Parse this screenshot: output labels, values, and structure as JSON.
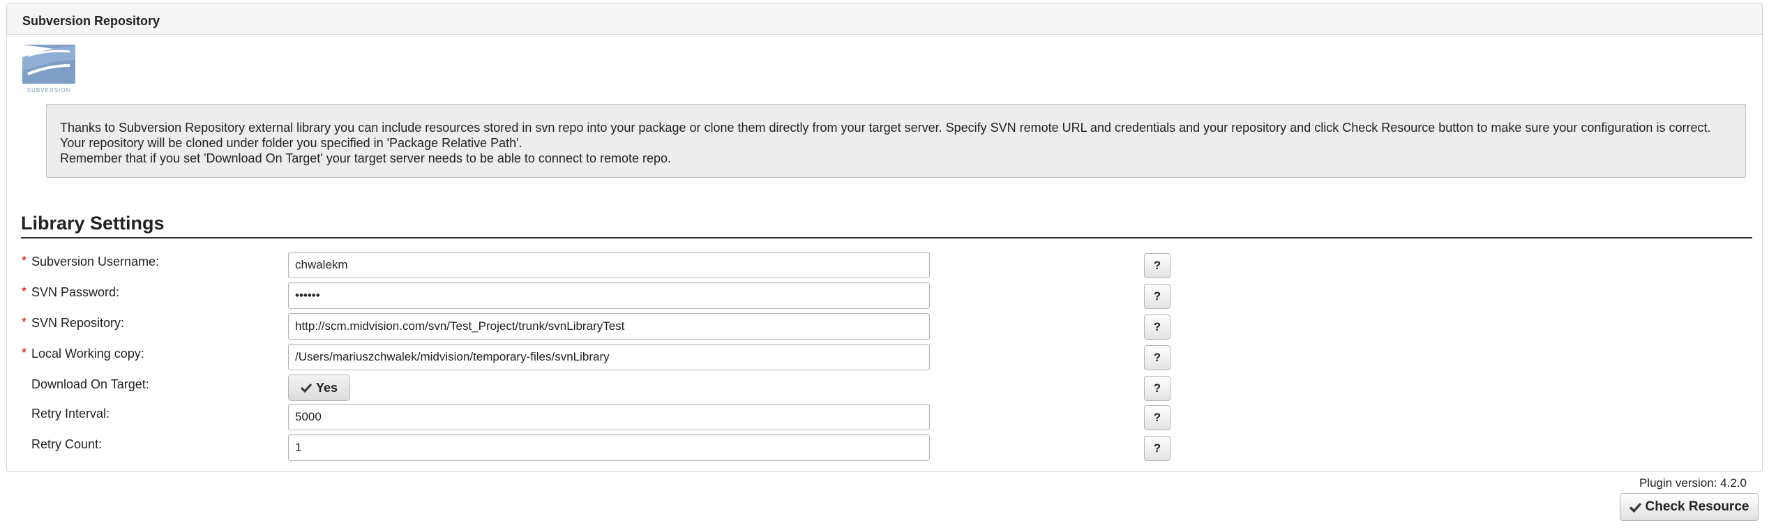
{
  "panel": {
    "title": "Subversion Repository"
  },
  "logo": {
    "icon": "subversion-logo",
    "text": "SUBVERSION"
  },
  "info": {
    "lines": [
      "Thanks to Subversion Repository external library you can include resources stored in svn repo into your package or clone them directly from your target server. Specify SVN remote URL and credentials and your repository and click Check Resource button to make sure your configuration is correct.",
      "Your repository will be cloned under folder you specified in 'Package Relative Path'.",
      "Remember that if you set 'Download On Target' your target server needs to be able to connect to remote repo."
    ]
  },
  "section": {
    "title": "Library Settings"
  },
  "fields": [
    {
      "required": "*",
      "label": "Subversion Username:",
      "value": "chwalekm",
      "help": "?"
    },
    {
      "required": "*",
      "label": "SVN Password:",
      "value": "••••••",
      "help": "?"
    },
    {
      "required": "*",
      "label": "SVN Repository:",
      "value": "http://scm.midvision.com/svn/Test_Project/trunk/svnLibraryTest",
      "help": "?"
    },
    {
      "required": "*",
      "label": "Local Working copy:",
      "value": "/Users/mariuszchwalek/midvision/temporary-files/svnLibrary",
      "help": "?"
    },
    {
      "required": "",
      "label": "Download On Target:",
      "value": "Yes",
      "help": "?"
    },
    {
      "required": "",
      "label": "Retry Interval:",
      "value": "5000",
      "help": "?"
    },
    {
      "required": "",
      "label": "Retry Count:",
      "value": "1",
      "help": "?"
    }
  ],
  "footer": {
    "version": "Plugin version: 4.2.0",
    "check_button": "Check Resource"
  },
  "colors": {
    "required": "#cc0000",
    "info_bg": "#ededed",
    "logo_blue": "#7d9fc6"
  }
}
